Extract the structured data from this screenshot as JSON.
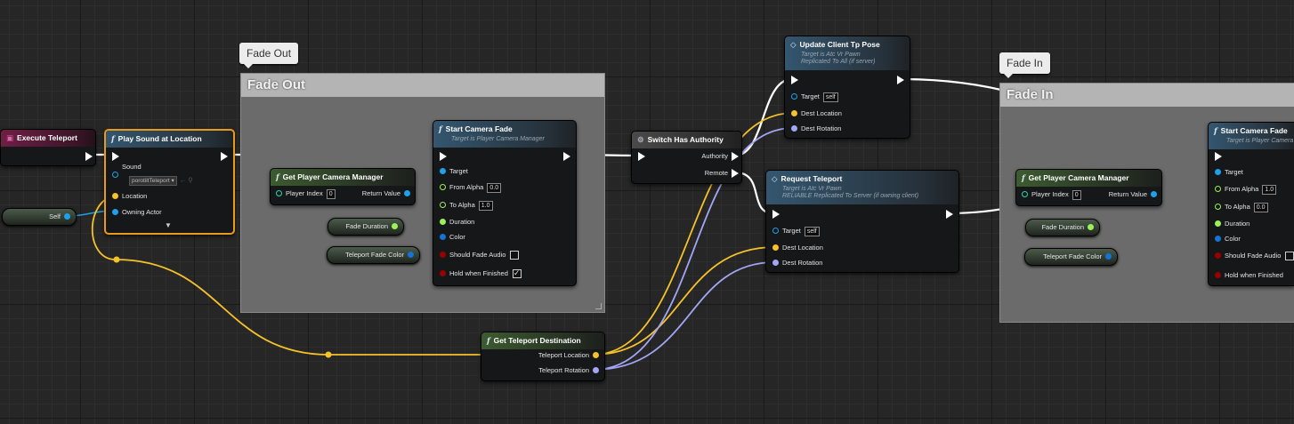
{
  "comments": {
    "fade_out": {
      "title": "Fade Out",
      "bubble": "Fade Out"
    },
    "fade_in": {
      "title": "Fade In",
      "bubble": "Fade In"
    }
  },
  "nodes": {
    "execute_teleport": {
      "title": "Execute Teleport"
    },
    "play_sound": {
      "title": "Play Sound at Location",
      "sound_label": "Sound",
      "sound_value": "porotiltTeleport",
      "location_label": "Location",
      "owning_actor_label": "Owning Actor"
    },
    "self_var": {
      "label": "Self"
    },
    "get_cam_mgr_1": {
      "title": "Get Player Camera Manager",
      "player_index_label": "Player Index",
      "player_index_value": "0",
      "return_label": "Return Value"
    },
    "fade_duration_1": {
      "label": "Fade Duration"
    },
    "teleport_fade_color_1": {
      "label": "Teleport Fade Color"
    },
    "start_fade_1": {
      "title": "Start Camera Fade",
      "subtitle": "Target is Player Camera Manager",
      "target": "Target",
      "from_alpha": "From Alpha",
      "from_alpha_value": "0.0",
      "to_alpha": "To Alpha",
      "to_alpha_value": "1.0",
      "duration": "Duration",
      "color": "Color",
      "should_fade_audio": "Should Fade Audio",
      "hold_when_finished": "Hold when Finished"
    },
    "switch_authority": {
      "title": "Switch Has Authority",
      "authority": "Authority",
      "remote": "Remote"
    },
    "update_client": {
      "title": "Update Client Tp Pose",
      "subtitle1": "Target is Atc Vr Pawn",
      "subtitle2": "Replicated To All (if server)",
      "target": "Target",
      "target_value": "self",
      "dest_location": "Dest Location",
      "dest_rotation": "Dest Rotation"
    },
    "request_teleport": {
      "title": "Request Teleport",
      "subtitle1": "Target is Atc Vr Pawn",
      "subtitle2": "RELIABLE Replicated To Server (if owning client)",
      "target": "Target",
      "target_value": "self",
      "dest_location": "Dest Location",
      "dest_rotation": "Dest Rotation"
    },
    "get_teleport_dest": {
      "title": "Get Teleport Destination",
      "teleport_location": "Teleport Location",
      "teleport_rotation": "Teleport Rotation"
    },
    "get_cam_mgr_2": {
      "title": "Get Player Camera Manager",
      "player_index_label": "Player Index",
      "player_index_value": "0",
      "return_label": "Return Value"
    },
    "fade_duration_2": {
      "label": "Fade Duration"
    },
    "teleport_fade_color_2": {
      "label": "Teleport Fade Color"
    },
    "start_fade_2": {
      "title": "Start Camera Fade",
      "subtitle": "Target is Player Camera Manager",
      "target": "Target",
      "from_alpha": "From Alpha",
      "from_alpha_value": "1.0",
      "to_alpha": "To Alpha",
      "to_alpha_value": "0.0",
      "duration": "Duration",
      "color": "Color",
      "should_fade_audio": "Should Fade Audio",
      "hold_when_finished": "Hold when Finished"
    }
  },
  "colors": {
    "exec": "#ffffff",
    "vector": "#f5c22a",
    "rotator": "#a3a6f5",
    "object": "#1ea1e8",
    "float": "#9ef05a",
    "struct_color": "#1473d6",
    "bool": "#9b0000",
    "selected": "#e89b1b"
  }
}
